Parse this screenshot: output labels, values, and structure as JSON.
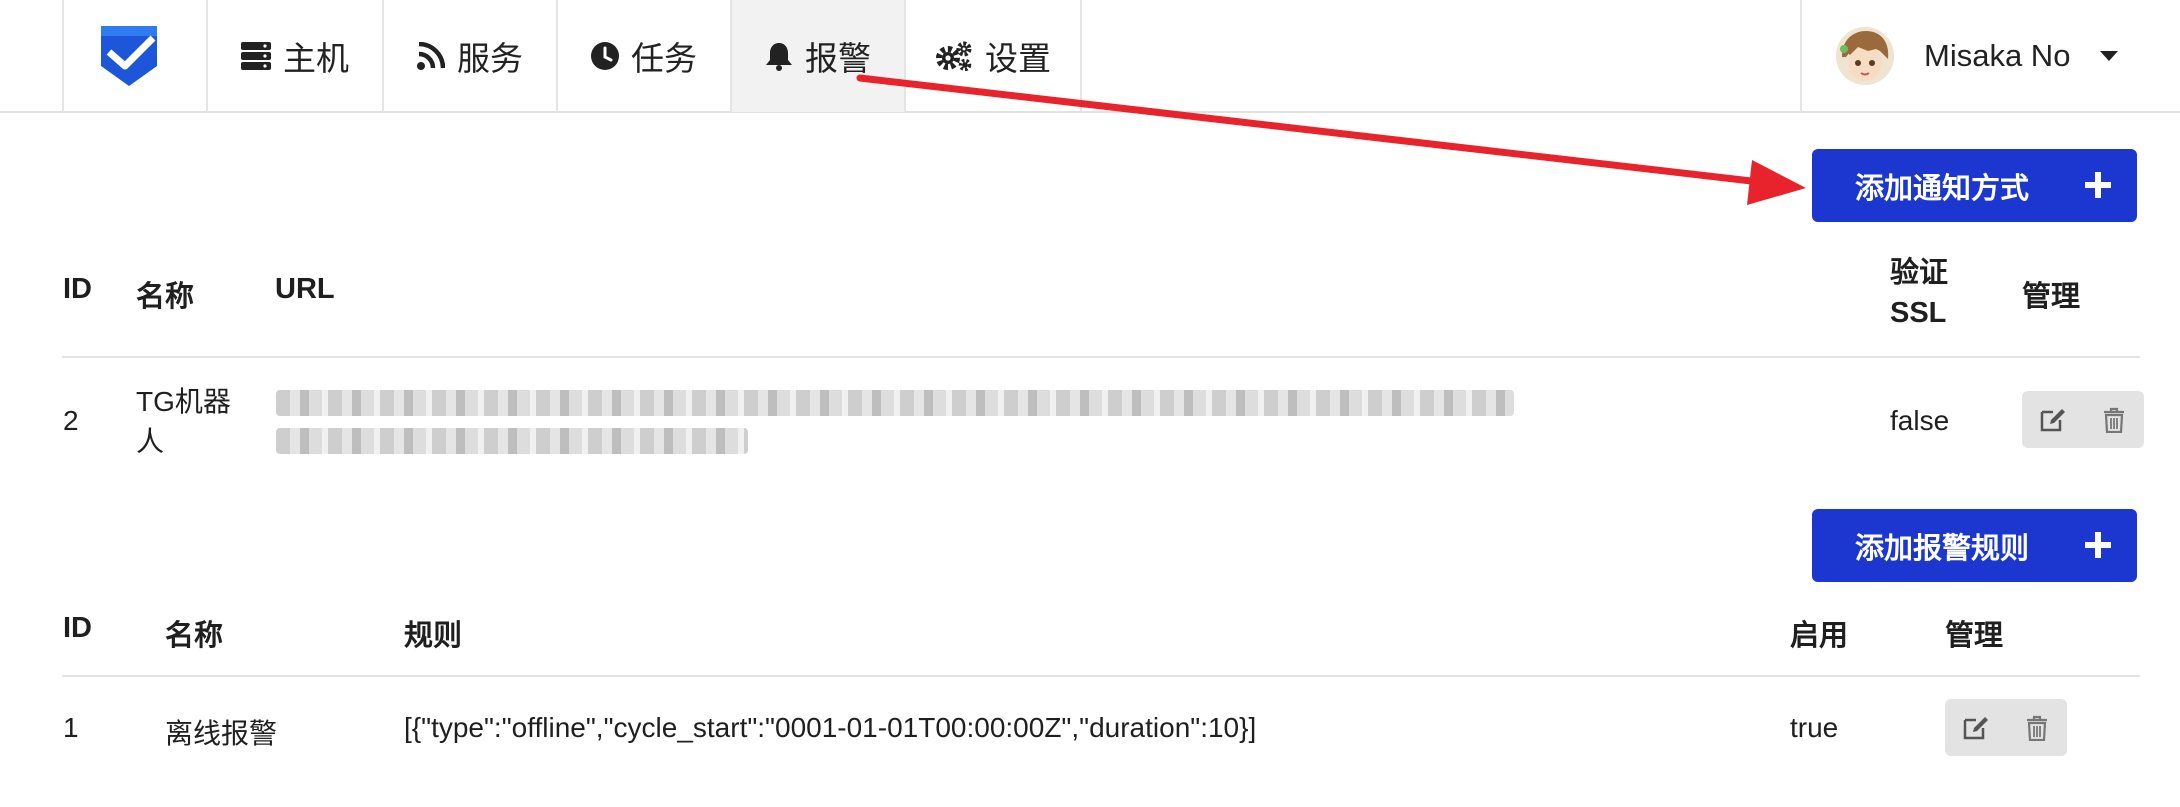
{
  "nav": {
    "items": [
      {
        "label": "主机",
        "icon": "server-icon"
      },
      {
        "label": "服务",
        "icon": "rss-icon"
      },
      {
        "label": "任务",
        "icon": "clock-icon"
      },
      {
        "label": "报警",
        "icon": "bell-icon",
        "active": true
      },
      {
        "label": "设置",
        "icon": "gears-icon"
      }
    ],
    "user_name": "Misaka No"
  },
  "notifications": {
    "add_button": "添加通知方式",
    "headers": {
      "id": "ID",
      "name": "名称",
      "url": "URL",
      "verify_ssl": "验证 SSL",
      "manage": "管理"
    },
    "rows": [
      {
        "id": "2",
        "name": "TG机器人",
        "verify_ssl": "false"
      }
    ]
  },
  "alert_rules": {
    "add_button": "添加报警规则",
    "headers": {
      "id": "ID",
      "name": "名称",
      "rule": "规则",
      "enabled": "启用",
      "manage": "管理"
    },
    "rows": [
      {
        "id": "1",
        "name": "离线报警",
        "rule": "[{\"type\":\"offline\",\"cycle_start\":\"0001-01-01T00:00:00Z\",\"duration\":10}]",
        "enabled": "true"
      }
    ]
  },
  "colors": {
    "primary": "#1b37cf",
    "annotation_arrow": "#e8232b",
    "active_tab": "#f2f2f2"
  }
}
